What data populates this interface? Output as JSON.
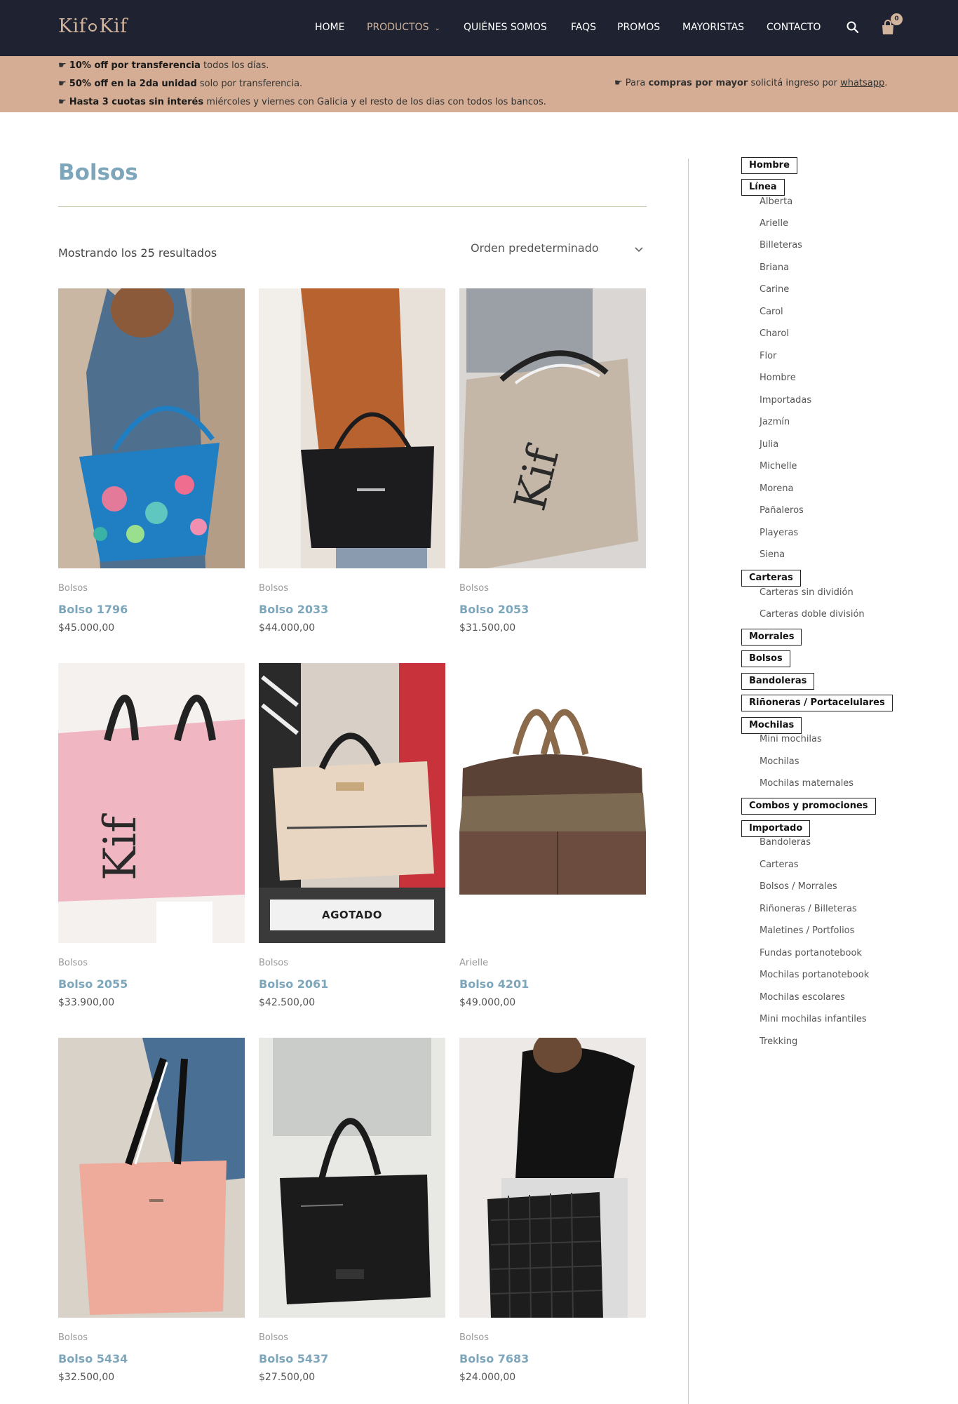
{
  "header": {
    "logo_left": "Kif",
    "logo_right": "Kif",
    "nav": [
      {
        "label": "HOME",
        "active": false
      },
      {
        "label": "PRODUCTOS",
        "active": true,
        "has_dropdown": true
      },
      {
        "label": "QUIÉNES SOMOS",
        "active": false
      },
      {
        "label": "FAQS",
        "active": false
      },
      {
        "label": "PROMOS",
        "active": false
      },
      {
        "label": "MAYORISTAS",
        "active": false
      },
      {
        "label": "CONTACTO",
        "active": false
      }
    ],
    "cart_count": "0",
    "icons": {
      "search": "search-icon",
      "cart": "shopping-bag-icon",
      "dropdown": "chevron-down-icon"
    },
    "colors": {
      "header_bg": "#1f2230",
      "accent": "#d2b49c"
    }
  },
  "promo": {
    "bullet": "☛",
    "lines": [
      {
        "bold": "10% off por transferencia",
        "rest": " todos los días."
      },
      {
        "bold": "50% off en la 2da unidad",
        "rest": " solo por transferencia."
      },
      {
        "bold": "Hasta 3 cuotas sin interés",
        "rest": " miércoles y viernes con Galicia y el resto de los dias con todos los bancos."
      }
    ],
    "right": {
      "pre": "Para ",
      "bold": "compras por mayor",
      "mid": " solicitá ingreso por ",
      "link": "whatsapp",
      "post": "."
    },
    "bg_color": "#d4ad94"
  },
  "main": {
    "title": "Bolsos",
    "result_count": "Mostrando los 25 resultados",
    "orderby": "Orden predeterminado",
    "products": [
      {
        "category": "Bolsos",
        "name": "Bolso 1796",
        "price": "$45.000,00",
        "sold_out": false
      },
      {
        "category": "Bolsos",
        "name": "Bolso 2033",
        "price": "$44.000,00",
        "sold_out": false
      },
      {
        "category": "Bolsos",
        "name": "Bolso 2053",
        "price": "$31.500,00",
        "sold_out": false
      },
      {
        "category": "Bolsos",
        "name": "Bolso 2055",
        "price": "$33.900,00",
        "sold_out": false
      },
      {
        "category": "Bolsos",
        "name": "Bolso 2061",
        "price": "$42.500,00",
        "sold_out": true
      },
      {
        "category": "Arielle",
        "name": "Bolso 4201",
        "price": "$49.000,00",
        "sold_out": false
      },
      {
        "category": "Bolsos",
        "name": "Bolso 5434",
        "price": "$32.500,00",
        "sold_out": false
      },
      {
        "category": "Bolsos",
        "name": "Bolso 5437",
        "price": "$27.500,00",
        "sold_out": false
      },
      {
        "category": "Bolsos",
        "name": "Bolso 7683",
        "price": "$24.000,00",
        "sold_out": false
      }
    ],
    "sold_out_label": "AGOTADO",
    "bag_print": "Kif"
  },
  "sidebar": {
    "groups": [
      {
        "label": "Hombre",
        "items": []
      },
      {
        "label": "Línea",
        "items": [
          "Alberta",
          "Arielle",
          "Billeteras",
          "Briana",
          "Carine",
          "Carol",
          "Charol",
          "Flor",
          "Hombre",
          "Importadas",
          "Jazmín",
          "Julia",
          "Michelle",
          "Morena",
          "Pañaleros",
          "Playeras",
          "Siena"
        ]
      },
      {
        "label": "Carteras",
        "items": [
          "Carteras sin dividión",
          "Carteras doble división"
        ]
      },
      {
        "label": "Morrales",
        "items": []
      },
      {
        "label": "Bolsos",
        "items": []
      },
      {
        "label": "Bandoleras",
        "items": []
      },
      {
        "label": "Riñoneras / Portacelulares",
        "items": []
      },
      {
        "label": "Mochilas",
        "items": [
          "Mini mochilas",
          "Mochilas",
          "Mochilas maternales"
        ]
      },
      {
        "label": "Combos y promociones",
        "items": []
      },
      {
        "label": "Importado",
        "items": [
          "Bandoleras",
          "Carteras",
          "Bolsos / Morrales",
          "Riñoneras / Billeteras",
          "Maletines / Portfolios",
          "Fundas portanotebook",
          "Mochilas portanotebook",
          "Mochilas escolares",
          "Mini mochilas infantiles",
          "Trekking"
        ]
      }
    ]
  }
}
